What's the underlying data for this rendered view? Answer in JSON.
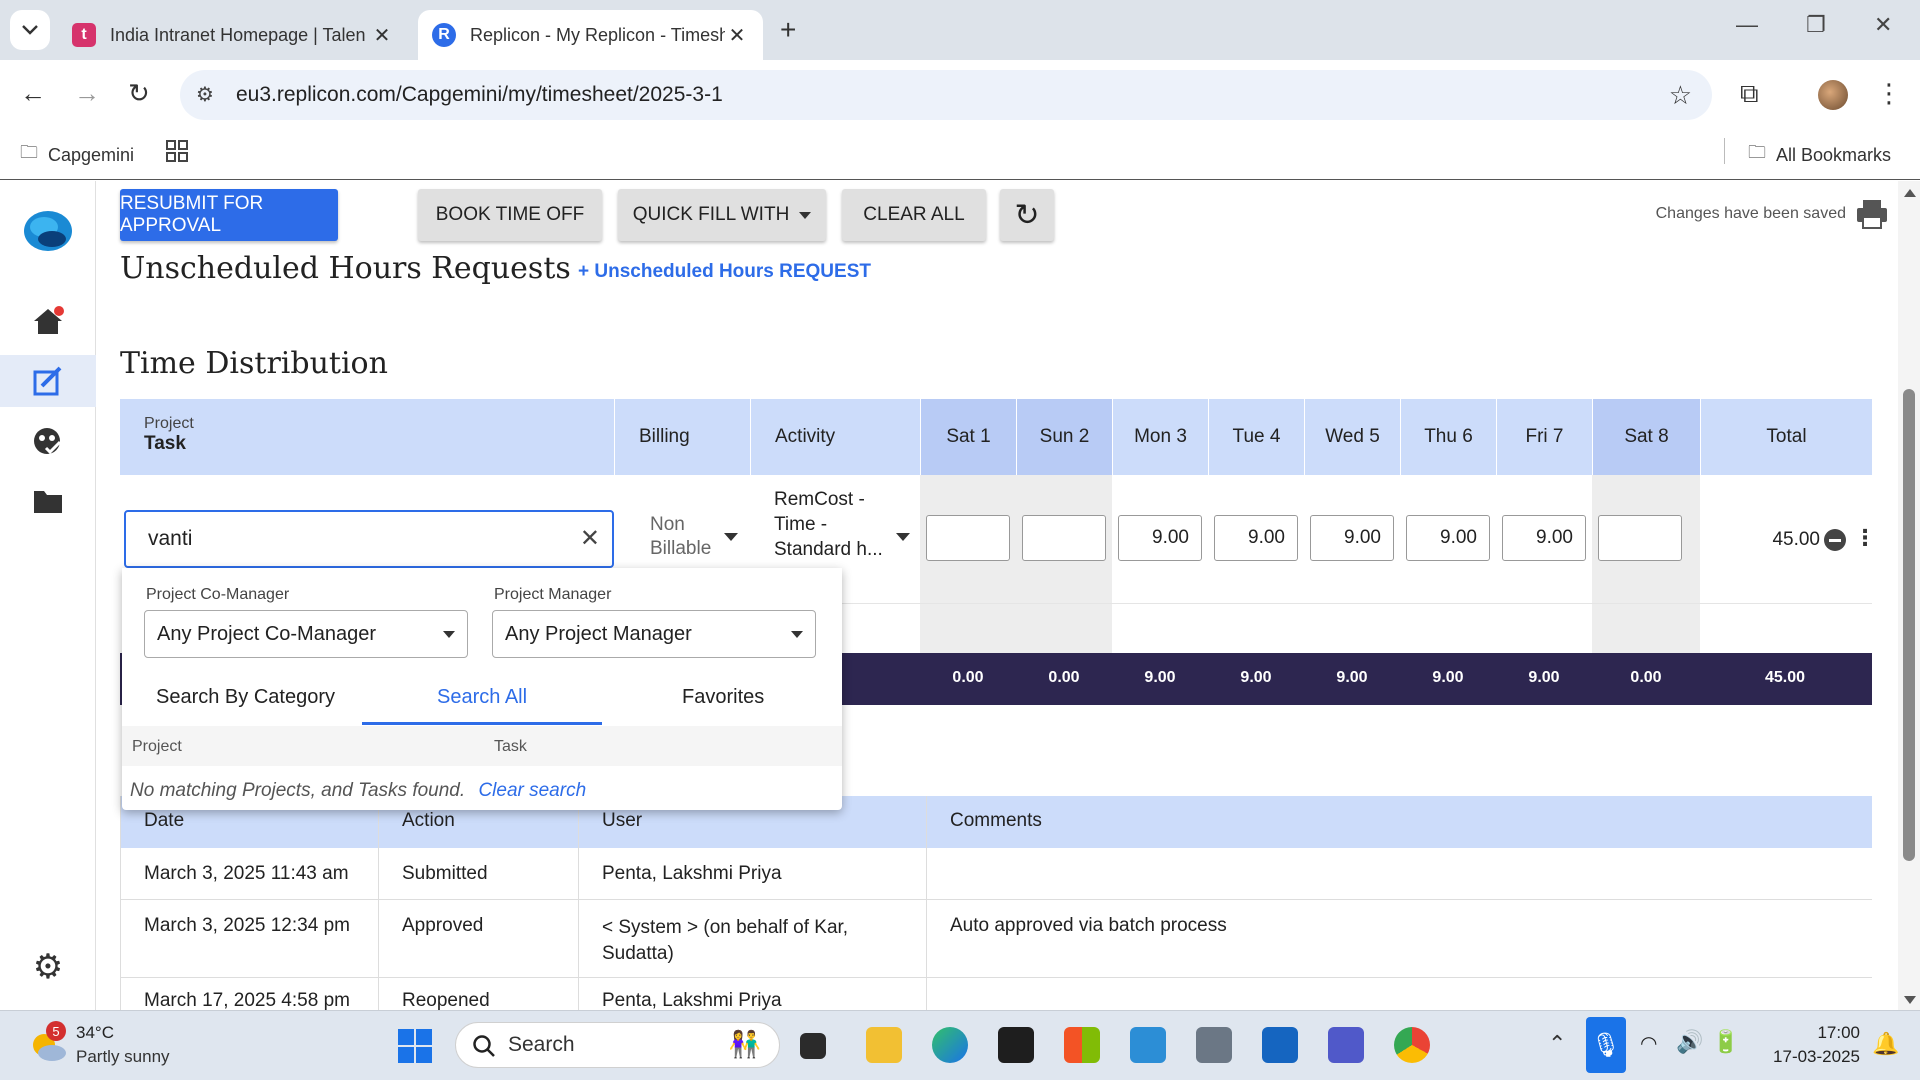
{
  "browser": {
    "tabs": [
      {
        "title": "India Intranet Homepage | Talen",
        "favicon_letter": "t",
        "favicon_color": "#d6336c"
      },
      {
        "title": "Replicon - My Replicon - Timesh",
        "favicon_letter": "R",
        "favicon_color": "#2d6ce8"
      }
    ],
    "url": "eu3.replicon.com/Capgemini/my/timesheet/2025-3-1",
    "bookmarks": {
      "folder": "Capgemini",
      "all": "All Bookmarks"
    }
  },
  "toolbar": {
    "resubmit": "RESUBMIT FOR APPROVAL",
    "book_time_off": "BOOK TIME OFF",
    "quick_fill": "QUICK FILL WITH",
    "clear_all": "CLEAR ALL",
    "saved_status": "Changes have been saved"
  },
  "unscheduled": {
    "title": "Unscheduled Hours Requests",
    "add_link": "+ Unscheduled Hours REQUEST"
  },
  "time_distribution": {
    "title": "Time Distribution",
    "header": {
      "project_label": "Project",
      "task_label": "Task",
      "billing": "Billing",
      "activity": "Activity",
      "days": [
        "Sat 1",
        "Sun 2",
        "Mon 3",
        "Tue 4",
        "Wed 5",
        "Thu 6",
        "Fri 7",
        "Sat 8"
      ],
      "total": "Total"
    },
    "row": {
      "search_value": "vanti",
      "billing": "Non Billable",
      "activity": "RemCost - Time - Standard h...",
      "hours": [
        "",
        "",
        "9.00",
        "9.00",
        "9.00",
        "9.00",
        "9.00",
        ""
      ],
      "total": "45.00"
    },
    "totals": [
      "0.00",
      "0.00",
      "9.00",
      "9.00",
      "9.00",
      "9.00",
      "9.00",
      "0.00"
    ],
    "grand_total": "45.00"
  },
  "search_dropdown": {
    "co_manager_label": "Project Co-Manager",
    "co_manager_value": "Any Project Co-Manager",
    "manager_label": "Project Manager",
    "manager_value": "Any Project Manager",
    "tabs": [
      "Search By Category",
      "Search All",
      "Favorites"
    ],
    "active_tab": "Search All",
    "col_project": "Project",
    "col_task": "Task",
    "no_results": "No matching Projects, and Tasks found.",
    "clear_search": "Clear search"
  },
  "history": {
    "headers": [
      "Date",
      "Action",
      "User",
      "Comments"
    ],
    "rows": [
      {
        "date": "March 3, 2025 11:43 am",
        "action": "Submitted",
        "user": "Penta, Lakshmi Priya",
        "comment": ""
      },
      {
        "date": "March 3, 2025 12:34 pm",
        "action": "Approved",
        "user": "< System > (on behalf of Kar, Sudatta)",
        "comment": "Auto approved via batch process"
      },
      {
        "date": "March 17, 2025 4:58 pm",
        "action": "Reopened",
        "user": "Penta, Lakshmi Priya",
        "comment": ""
      }
    ]
  },
  "taskbar": {
    "weather_temp": "34°C",
    "weather_desc": "Partly sunny",
    "weather_badge": "5",
    "search_placeholder": "Search",
    "time": "17:00",
    "date": "17-03-2025"
  },
  "colors": {
    "accent": "#2d6ce8",
    "header_blue": "#ccdcfa",
    "total_bar": "#2d2650"
  }
}
